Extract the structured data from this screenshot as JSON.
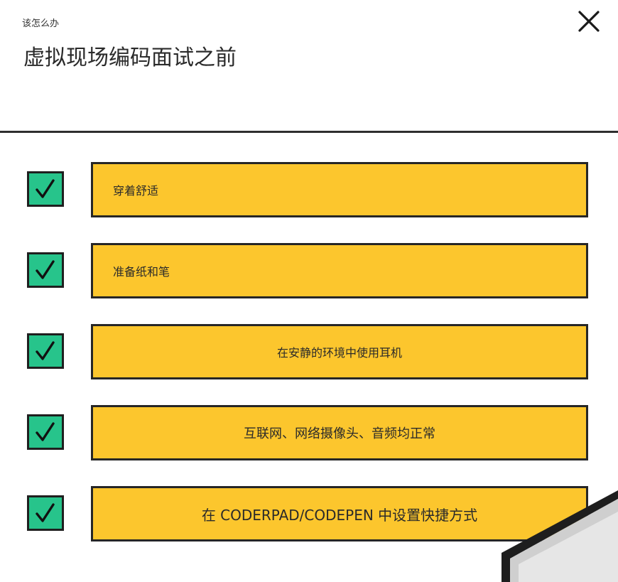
{
  "header": {
    "eyebrow": "该怎么办",
    "title": "虚拟现场编码面试之前"
  },
  "icons": {
    "close": "close-icon",
    "check": "checkmark-icon"
  },
  "colors": {
    "card_fill": "#fcc62d",
    "check_fill": "#27c48b",
    "outline": "#262626"
  },
  "checklist": [
    {
      "label": "穿着舒适",
      "checked": true
    },
    {
      "label": "准备纸和笔",
      "checked": true
    },
    {
      "label": "在安静的环境中使用耳机",
      "checked": true
    },
    {
      "label": "互联网、网络摄像头、音频均正常",
      "checked": true
    },
    {
      "label": "在 CODERPAD/CODEPEN 中设置快捷方式",
      "checked": true
    }
  ]
}
